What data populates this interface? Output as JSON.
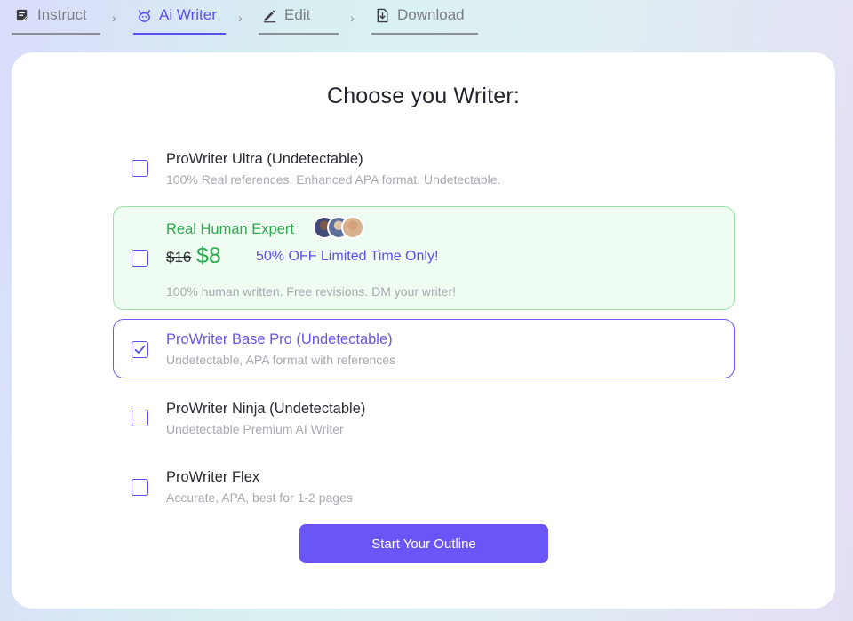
{
  "stepper": {
    "steps": [
      {
        "label": "Instruct",
        "icon": "edit-note-icon"
      },
      {
        "label": "Ai Writer",
        "icon": "robot-icon",
        "active": true
      },
      {
        "label": "Edit",
        "icon": "pencil-icon"
      },
      {
        "label": "Download",
        "icon": "file-download-icon"
      }
    ],
    "separator": "›"
  },
  "card": {
    "title": "Choose you Writer:",
    "options": [
      {
        "title": "ProWriter Ultra (Undetectable)",
        "desc": "100% Real references. Enhanced APA format. Undetectable.",
        "checked": false
      },
      {
        "title": "Real Human Expert",
        "old_price": "$16",
        "new_price": "$8",
        "promo": "50% OFF Limited Time Only!",
        "desc": "100% human written. Free revisions. DM your writer!",
        "checked": false
      },
      {
        "title": "ProWriter Base Pro (Undetectable)",
        "desc": "Undetectable, APA format with references",
        "checked": true
      },
      {
        "title": "ProWriter Ninja (Undetectable)",
        "desc": "Undetectable Premium AI Writer",
        "checked": false
      },
      {
        "title": "ProWriter Flex",
        "desc": "Accurate, APA, best for 1-2 pages",
        "checked": false
      }
    ],
    "start_button": "Start Your Outline"
  },
  "colors": {
    "accent": "#6a55f7",
    "green": "#2fa84f",
    "green_bg": "#effcf1",
    "muted": "#a9a9b2"
  }
}
